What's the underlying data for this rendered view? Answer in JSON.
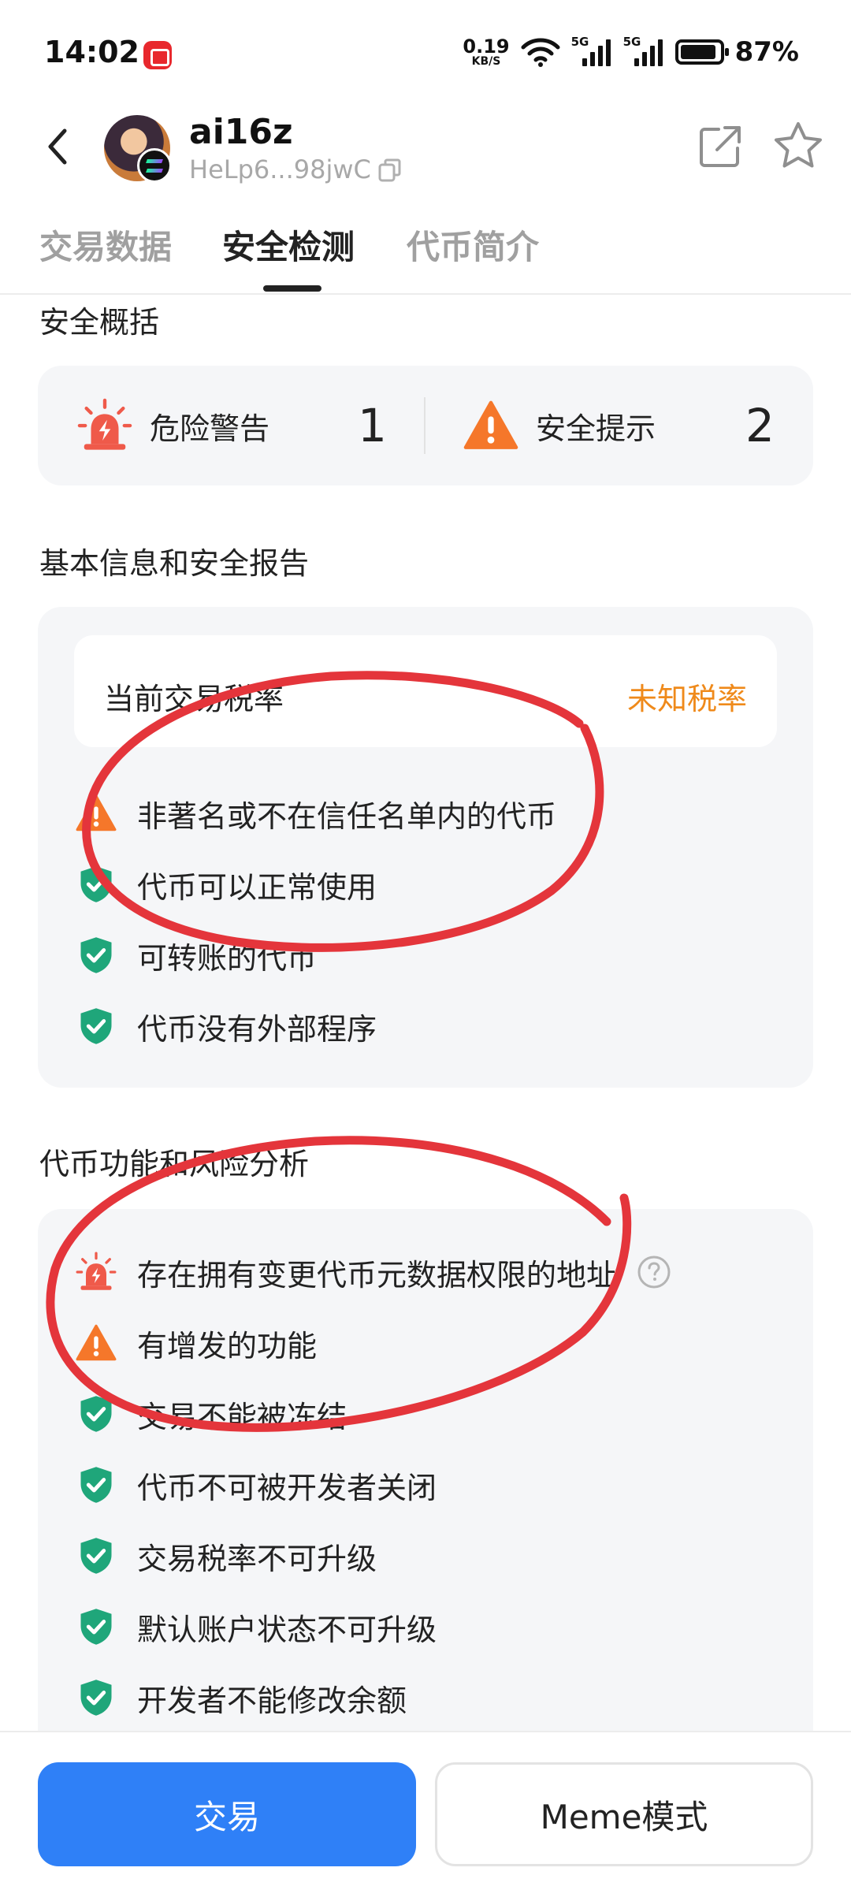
{
  "status_bar": {
    "time": "14:02",
    "net_speed_value": "0.19",
    "net_speed_unit": "KB/S",
    "signal1_label": "5G",
    "signal2_label": "5G",
    "battery": "87%"
  },
  "header": {
    "token_name": "ai16z",
    "token_address": "HeLp6...98jwC"
  },
  "tabs": [
    {
      "label": "交易数据",
      "active": false
    },
    {
      "label": "安全检测",
      "active": true
    },
    {
      "label": "代币简介",
      "active": false
    }
  ],
  "summary": {
    "title": "安全概括",
    "danger_label": "危险警告",
    "danger_count": "1",
    "tip_label": "安全提示",
    "tip_count": "2"
  },
  "basic_info": {
    "title": "基本信息和安全报告",
    "tax_label": "当前交易税率",
    "tax_value": "未知税率",
    "items": [
      {
        "text": "非著名或不在信任名单内的代币",
        "status": "warning"
      },
      {
        "text": "代币可以正常使用",
        "status": "safe"
      },
      {
        "text": "可转账的代币",
        "status": "safe"
      },
      {
        "text": "代币没有外部程序",
        "status": "safe"
      }
    ]
  },
  "function_risk": {
    "title": "代币功能和风险分析",
    "items": [
      {
        "text": "存在拥有变更代币元数据权限的地址",
        "status": "danger",
        "has_help": true
      },
      {
        "text": "有增发的功能",
        "status": "warning"
      },
      {
        "text": "交易不能被冻结",
        "status": "safe"
      },
      {
        "text": "代币不可被开发者关闭",
        "status": "safe"
      },
      {
        "text": "交易税率不可升级",
        "status": "safe"
      },
      {
        "text": "默认账户状态不可升级",
        "status": "safe"
      },
      {
        "text": "开发者不能修改余额",
        "status": "safe"
      }
    ]
  },
  "bottom": {
    "trade_label": "交易",
    "meme_label": "Meme模式"
  },
  "colors": {
    "accent_blue": "#2f80f7",
    "safe_green": "#1fa67a",
    "warning_orange": "#f5772a",
    "danger_red": "#ef5a4a",
    "tax_orange": "#ef8a1b",
    "annotation_red": "#e4353b"
  }
}
